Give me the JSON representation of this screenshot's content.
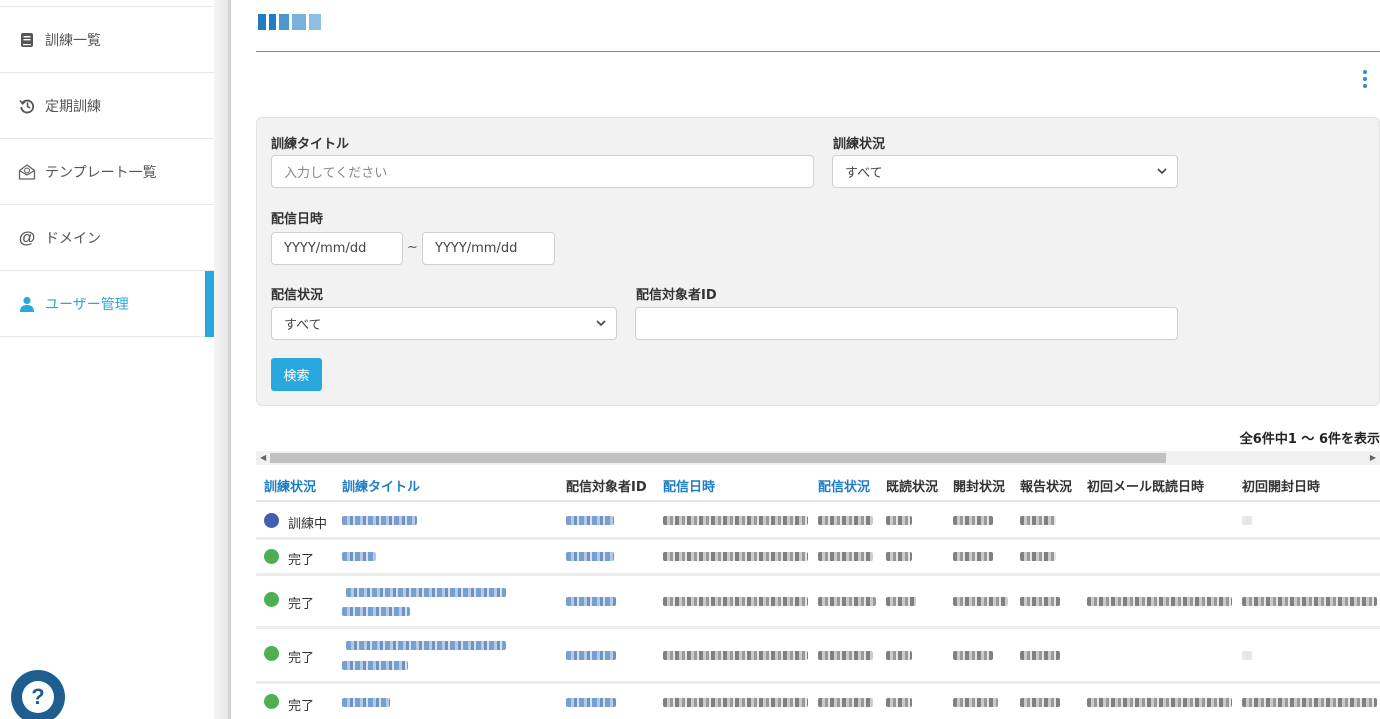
{
  "sidebar": {
    "items": [
      {
        "label": "訓練一覧",
        "icon": "book-icon"
      },
      {
        "label": "定期訓練",
        "icon": "history-icon"
      },
      {
        "label": "テンプレート一覧",
        "icon": "mail-template-icon"
      },
      {
        "label": "ドメイン",
        "icon": "at-icon"
      },
      {
        "label": "ユーザー管理",
        "icon": "user-icon",
        "active": true
      }
    ]
  },
  "help": {
    "glyph": "?"
  },
  "search": {
    "title_label": "訓練タイトル",
    "title_placeholder": "入力してください",
    "status_label": "訓練状況",
    "status_value": "すべて",
    "date_label": "配信日時",
    "date_from_placeholder": "YYYY/mm/dd",
    "date_separator": "~",
    "date_to_placeholder": "YYYY/mm/dd",
    "delivery_status_label": "配信状況",
    "delivery_status_value": "すべて",
    "target_id_label": "配信対象者ID",
    "target_id_value": "",
    "button_label": "検索"
  },
  "results": {
    "count_text": "全6件中1 ～ 6件を表示"
  },
  "table": {
    "headers": {
      "training_status": "訓練状況",
      "training_title": "訓練タイトル",
      "target_id": "配信対象者ID",
      "delivery_date": "配信日時",
      "delivery_status": "配信状況",
      "read_status": "既読状況",
      "open_status": "開封状況",
      "report_status": "報告状況",
      "first_read": "初回メール既読日時",
      "first_open": "初回開封日時"
    },
    "rows": [
      {
        "status": "訓練中",
        "status_color": "#3f5fb5"
      },
      {
        "status": "完了",
        "status_color": "#4caf50"
      },
      {
        "status": "完了",
        "status_color": "#4caf50"
      },
      {
        "status": "完了",
        "status_color": "#4caf50"
      },
      {
        "status": "完了",
        "status_color": "#4caf50"
      }
    ]
  },
  "colors": {
    "accent": "#29a8df",
    "link": "#1e7dc4",
    "help": "#1e5e8f"
  }
}
